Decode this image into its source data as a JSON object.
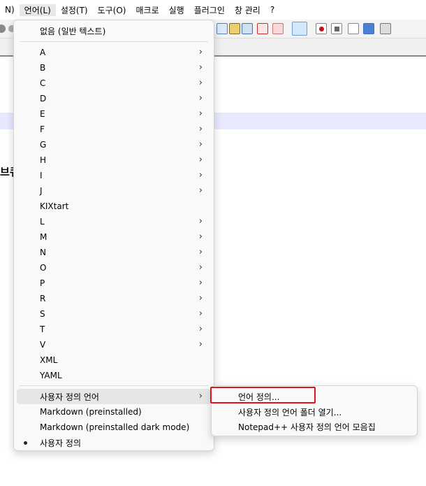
{
  "menubar": {
    "items": [
      {
        "label": "N)"
      },
      {
        "label": "언어(L)"
      },
      {
        "label": "설정(T)"
      },
      {
        "label": "도구(O)"
      },
      {
        "label": "매크로"
      },
      {
        "label": "실행"
      },
      {
        "label": "플러그인"
      },
      {
        "label": "창 관리"
      },
      {
        "label": "?"
      }
    ]
  },
  "editor": {
    "peek_text": "브큐"
  },
  "language_menu": {
    "none": "없음 (일반 텍스트)",
    "letters": [
      {
        "label": "A"
      },
      {
        "label": "B"
      },
      {
        "label": "C"
      },
      {
        "label": "D"
      },
      {
        "label": "E"
      },
      {
        "label": "F"
      },
      {
        "label": "G"
      },
      {
        "label": "H"
      },
      {
        "label": "I"
      },
      {
        "label": "J"
      },
      {
        "label": "KIXtart"
      },
      {
        "label": "L"
      },
      {
        "label": "M"
      },
      {
        "label": "N"
      },
      {
        "label": "O"
      },
      {
        "label": "P"
      },
      {
        "label": "R"
      },
      {
        "label": "S"
      },
      {
        "label": "T"
      },
      {
        "label": "V"
      },
      {
        "label": "XML"
      },
      {
        "label": "YAML"
      }
    ],
    "user_defined_language": "사용자 정의 언어",
    "markdown": "Markdown (preinstalled)",
    "markdown_dark": "Markdown (preinstalled dark mode)",
    "user_defined": "사용자 정의",
    "arrow_glyph": "›"
  },
  "submenu": {
    "define_language": "언어 정의...",
    "open_folder": "사용자 정의 언어 폴더 열기...",
    "collection": "Notepad++ 사용자 정의 언어 모음집"
  },
  "colors": {
    "highlight_box": "#e0141e",
    "current_line": "#e8e8ff"
  }
}
